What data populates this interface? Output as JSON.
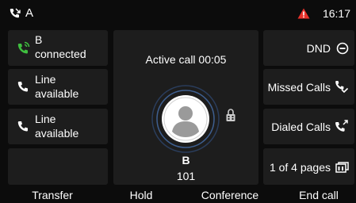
{
  "status_bar": {
    "account": "A",
    "time": "16:17",
    "warning_color": "#e8312a"
  },
  "lines": [
    {
      "line1": "B",
      "line2": "connected",
      "icon": "phone-connected-icon",
      "color": "#3fbf3f"
    },
    {
      "line1": "Line",
      "line2": "available",
      "icon": "phone-icon",
      "color": "#ffffff"
    },
    {
      "line1": "Line",
      "line2": "available",
      "icon": "phone-icon",
      "color": "#ffffff"
    },
    {
      "line1": "",
      "line2": "",
      "icon": "",
      "color": "#ffffff"
    }
  ],
  "call": {
    "status": "Active call 00:05",
    "name": "B",
    "number": "101",
    "security_icon": "encryption-icon"
  },
  "side_buttons": [
    {
      "label": "DND",
      "icon": "dnd-icon"
    },
    {
      "label": "Missed Calls",
      "icon": "missed-calls-icon"
    },
    {
      "label": "Dialed Calls",
      "icon": "dialed-calls-icon"
    },
    {
      "label": "1 of 4 pages",
      "icon": "pages-icon"
    }
  ],
  "softkeys": [
    "Transfer",
    "Hold",
    "Conference",
    "End call"
  ]
}
